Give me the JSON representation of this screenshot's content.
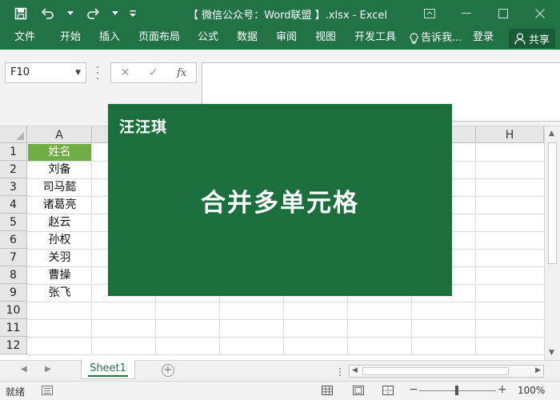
{
  "window": {
    "title": "【 微信公众号：Word联盟 】.xlsx - Excel",
    "accent": "#217346"
  },
  "qat": {
    "icons": [
      "save-icon",
      "undo-icon",
      "redo-icon",
      "customize-icon"
    ]
  },
  "ribbon": {
    "tabs": [
      "文件",
      "开始",
      "插入",
      "页面布局",
      "公式",
      "数据",
      "审阅",
      "视图",
      "开发工具"
    ],
    "tell_me": "告诉我...",
    "sign_in": "登录",
    "share": "共享"
  },
  "formula_bar": {
    "name_box": "F10",
    "cancel_icon": "✕",
    "enter_icon": "✓",
    "fx_label": "fx",
    "content": ""
  },
  "grid": {
    "columns": [
      "A",
      "H"
    ],
    "rows": [
      "1",
      "2",
      "3",
      "4",
      "5",
      "6",
      "7",
      "8",
      "9",
      "10",
      "11",
      "12"
    ],
    "cells_col_a": [
      "姓名",
      "刘备",
      "司马懿",
      "诸葛亮",
      "赵云",
      "孙权",
      "关羽",
      "曹操",
      "张飞"
    ],
    "header_color": "#70ad47"
  },
  "overlay": {
    "brand": "汪汪琪",
    "title": "合并多单元格",
    "color": "#1b6f3d"
  },
  "sheets": {
    "active": "Sheet1"
  },
  "status": {
    "ready": "就绪",
    "zoom": "100%"
  }
}
